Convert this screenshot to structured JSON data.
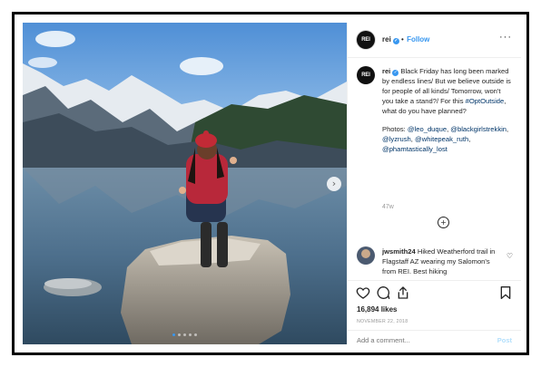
{
  "account": {
    "username": "rei",
    "avatar_text": "REI",
    "follow_label": "Follow",
    "separator": "•"
  },
  "caption": {
    "username": "rei",
    "text": "Black Friday has long been marked by endless lines/ But we believe outside is for people of all kinds/ Tomorrow, won't you take a stand?/ For this ",
    "hashtag": "#OptOutside",
    "text_after": ", what do you have planned?",
    "photos_label": "Photos: ",
    "credits": [
      "@leo_duque",
      "@blackgirlstrekkin",
      "@lyzrush",
      "@whitepeak_ruth",
      "@phamtastically_lost"
    ]
  },
  "time_ago": "47w",
  "comment": {
    "username": "jwsmith24",
    "text": "Hiked Weatherford trail in Flagstaff AZ wearing my Salomon's from REI. Best hiking"
  },
  "likes": "16,894 likes",
  "date": "NOVEMBER 22, 2018",
  "add_comment": {
    "placeholder": "Add a comment...",
    "post_label": "Post"
  },
  "icons": {
    "more": "more-options-icon",
    "like": "heart-icon",
    "comment": "comment-icon",
    "share": "share-icon",
    "save": "bookmark-icon",
    "next": "chevron-right-icon",
    "load_more": "plus-circle-icon"
  },
  "carousel": {
    "slides": 5,
    "active_index": 0
  },
  "colors": {
    "accent": "#3897f0",
    "text": "#262626",
    "muted": "#999999"
  }
}
